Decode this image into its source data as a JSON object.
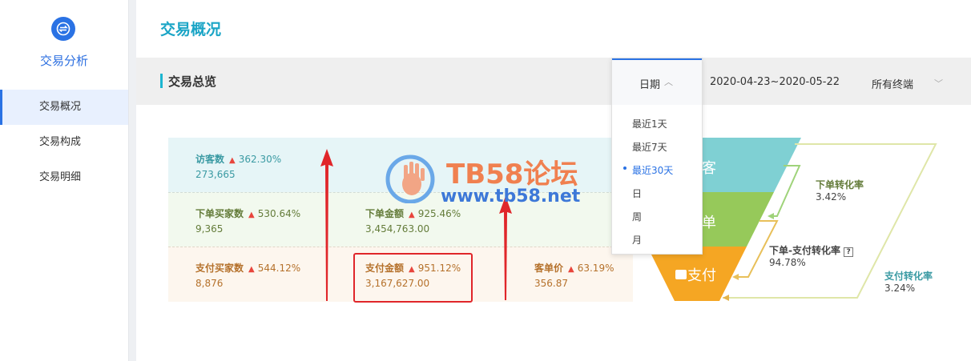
{
  "sidebar": {
    "title": "交易分析",
    "items": [
      {
        "label": "交易概况"
      },
      {
        "label": "交易构成"
      },
      {
        "label": "交易明细"
      }
    ]
  },
  "header": {
    "title": "交易概况"
  },
  "toolbar": {
    "section_title": "交易总览",
    "date_label": "日期",
    "date_range": "2020-04-23~2020-05-22",
    "terminal": "所有终端"
  },
  "date_menu": {
    "options": [
      "最近1天",
      "最近7天",
      "最近30天",
      "日",
      "周",
      "月"
    ],
    "selected": "最近30天"
  },
  "metrics": {
    "visitors": {
      "label": "访客数",
      "pct": "362.30%",
      "value": "273,665"
    },
    "order_buyers": {
      "label": "下单买家数",
      "pct": "530.64%",
      "value": "9,365"
    },
    "order_amount": {
      "label": "下单金额",
      "pct": "925.46%",
      "value": "3,454,763.00"
    },
    "pay_buyers": {
      "label": "支付买家数",
      "pct": "544.12%",
      "value": "8,876"
    },
    "pay_amount": {
      "label": "支付金额",
      "pct": "951.12%",
      "value": "3,167,627.00"
    },
    "unit_price": {
      "label": "客单价",
      "pct": "63.19%",
      "value": "356.87"
    }
  },
  "funnel": {
    "visit": "客",
    "order": "单",
    "pay": "支付"
  },
  "conversions": {
    "order_rate": {
      "label": "下单转化率",
      "value": "3.42%"
    },
    "order_pay_rate": {
      "label": "下单-支付转化率",
      "value": "94.78%"
    },
    "pay_rate": {
      "label": "支付转化率",
      "value": "3.24%"
    }
  },
  "watermark": {
    "name": "TB58论坛",
    "url": "www.tb58.net"
  },
  "colors": {
    "accent": "#2a72e4",
    "teal": "#7fd0d3",
    "green": "#96c95a",
    "orange": "#f5a623",
    "red": "#e0262a"
  }
}
